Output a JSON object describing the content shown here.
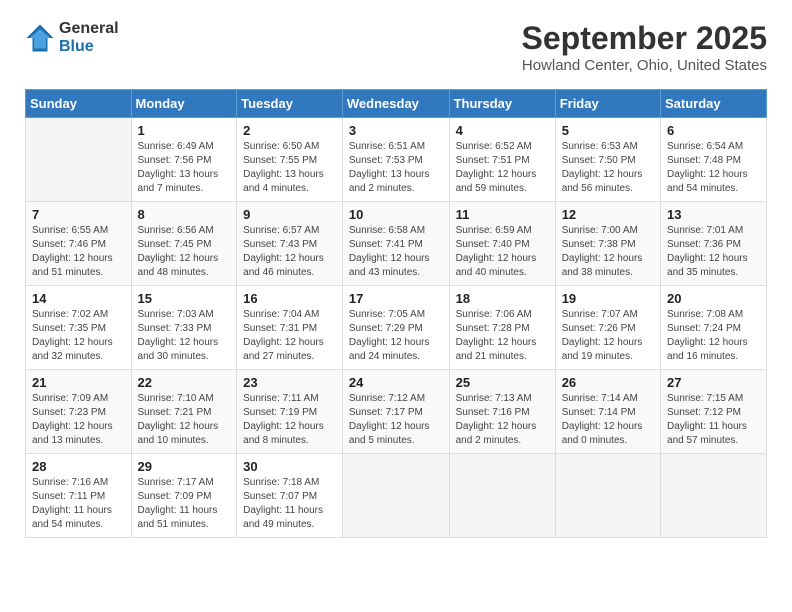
{
  "header": {
    "logo_general": "General",
    "logo_blue": "Blue",
    "month_year": "September 2025",
    "location": "Howland Center, Ohio, United States"
  },
  "days_of_week": [
    "Sunday",
    "Monday",
    "Tuesday",
    "Wednesday",
    "Thursday",
    "Friday",
    "Saturday"
  ],
  "weeks": [
    [
      {
        "day": "",
        "info": ""
      },
      {
        "day": "1",
        "info": "Sunrise: 6:49 AM\nSunset: 7:56 PM\nDaylight: 13 hours\nand 7 minutes."
      },
      {
        "day": "2",
        "info": "Sunrise: 6:50 AM\nSunset: 7:55 PM\nDaylight: 13 hours\nand 4 minutes."
      },
      {
        "day": "3",
        "info": "Sunrise: 6:51 AM\nSunset: 7:53 PM\nDaylight: 13 hours\nand 2 minutes."
      },
      {
        "day": "4",
        "info": "Sunrise: 6:52 AM\nSunset: 7:51 PM\nDaylight: 12 hours\nand 59 minutes."
      },
      {
        "day": "5",
        "info": "Sunrise: 6:53 AM\nSunset: 7:50 PM\nDaylight: 12 hours\nand 56 minutes."
      },
      {
        "day": "6",
        "info": "Sunrise: 6:54 AM\nSunset: 7:48 PM\nDaylight: 12 hours\nand 54 minutes."
      }
    ],
    [
      {
        "day": "7",
        "info": "Sunrise: 6:55 AM\nSunset: 7:46 PM\nDaylight: 12 hours\nand 51 minutes."
      },
      {
        "day": "8",
        "info": "Sunrise: 6:56 AM\nSunset: 7:45 PM\nDaylight: 12 hours\nand 48 minutes."
      },
      {
        "day": "9",
        "info": "Sunrise: 6:57 AM\nSunset: 7:43 PM\nDaylight: 12 hours\nand 46 minutes."
      },
      {
        "day": "10",
        "info": "Sunrise: 6:58 AM\nSunset: 7:41 PM\nDaylight: 12 hours\nand 43 minutes."
      },
      {
        "day": "11",
        "info": "Sunrise: 6:59 AM\nSunset: 7:40 PM\nDaylight: 12 hours\nand 40 minutes."
      },
      {
        "day": "12",
        "info": "Sunrise: 7:00 AM\nSunset: 7:38 PM\nDaylight: 12 hours\nand 38 minutes."
      },
      {
        "day": "13",
        "info": "Sunrise: 7:01 AM\nSunset: 7:36 PM\nDaylight: 12 hours\nand 35 minutes."
      }
    ],
    [
      {
        "day": "14",
        "info": "Sunrise: 7:02 AM\nSunset: 7:35 PM\nDaylight: 12 hours\nand 32 minutes."
      },
      {
        "day": "15",
        "info": "Sunrise: 7:03 AM\nSunset: 7:33 PM\nDaylight: 12 hours\nand 30 minutes."
      },
      {
        "day": "16",
        "info": "Sunrise: 7:04 AM\nSunset: 7:31 PM\nDaylight: 12 hours\nand 27 minutes."
      },
      {
        "day": "17",
        "info": "Sunrise: 7:05 AM\nSunset: 7:29 PM\nDaylight: 12 hours\nand 24 minutes."
      },
      {
        "day": "18",
        "info": "Sunrise: 7:06 AM\nSunset: 7:28 PM\nDaylight: 12 hours\nand 21 minutes."
      },
      {
        "day": "19",
        "info": "Sunrise: 7:07 AM\nSunset: 7:26 PM\nDaylight: 12 hours\nand 19 minutes."
      },
      {
        "day": "20",
        "info": "Sunrise: 7:08 AM\nSunset: 7:24 PM\nDaylight: 12 hours\nand 16 minutes."
      }
    ],
    [
      {
        "day": "21",
        "info": "Sunrise: 7:09 AM\nSunset: 7:23 PM\nDaylight: 12 hours\nand 13 minutes."
      },
      {
        "day": "22",
        "info": "Sunrise: 7:10 AM\nSunset: 7:21 PM\nDaylight: 12 hours\nand 10 minutes."
      },
      {
        "day": "23",
        "info": "Sunrise: 7:11 AM\nSunset: 7:19 PM\nDaylight: 12 hours\nand 8 minutes."
      },
      {
        "day": "24",
        "info": "Sunrise: 7:12 AM\nSunset: 7:17 PM\nDaylight: 12 hours\nand 5 minutes."
      },
      {
        "day": "25",
        "info": "Sunrise: 7:13 AM\nSunset: 7:16 PM\nDaylight: 12 hours\nand 2 minutes."
      },
      {
        "day": "26",
        "info": "Sunrise: 7:14 AM\nSunset: 7:14 PM\nDaylight: 12 hours\nand 0 minutes."
      },
      {
        "day": "27",
        "info": "Sunrise: 7:15 AM\nSunset: 7:12 PM\nDaylight: 11 hours\nand 57 minutes."
      }
    ],
    [
      {
        "day": "28",
        "info": "Sunrise: 7:16 AM\nSunset: 7:11 PM\nDaylight: 11 hours\nand 54 minutes."
      },
      {
        "day": "29",
        "info": "Sunrise: 7:17 AM\nSunset: 7:09 PM\nDaylight: 11 hours\nand 51 minutes."
      },
      {
        "day": "30",
        "info": "Sunrise: 7:18 AM\nSunset: 7:07 PM\nDaylight: 11 hours\nand 49 minutes."
      },
      {
        "day": "",
        "info": ""
      },
      {
        "day": "",
        "info": ""
      },
      {
        "day": "",
        "info": ""
      },
      {
        "day": "",
        "info": ""
      }
    ]
  ]
}
